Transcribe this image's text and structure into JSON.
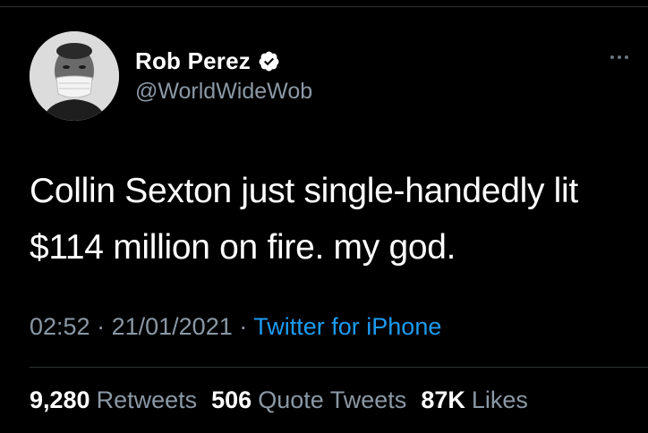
{
  "author": {
    "display_name": "Rob Perez",
    "handle": "@WorldWideWob",
    "verified_icon": "verified-badge-icon",
    "avatar_icon": "avatar"
  },
  "tweet": {
    "text": "Collin Sexton just single-handedly lit\n$114 million on fire. my god."
  },
  "meta": {
    "time": "02:52",
    "separator": "·",
    "date": "21/01/2021",
    "source": "Twitter for iPhone"
  },
  "stats": {
    "retweets_count": "9,280",
    "retweets_label": "Retweets",
    "quotes_count": "506",
    "quotes_label": "Quote Tweets",
    "likes_count": "87K",
    "likes_label": "Likes"
  },
  "colors": {
    "background": "#000000",
    "text_primary": "#ffffff",
    "text_secondary": "#8b98a5",
    "link": "#1d9bf0",
    "divider": "#2f3336"
  },
  "icons": {
    "more": "more-options-icon"
  }
}
